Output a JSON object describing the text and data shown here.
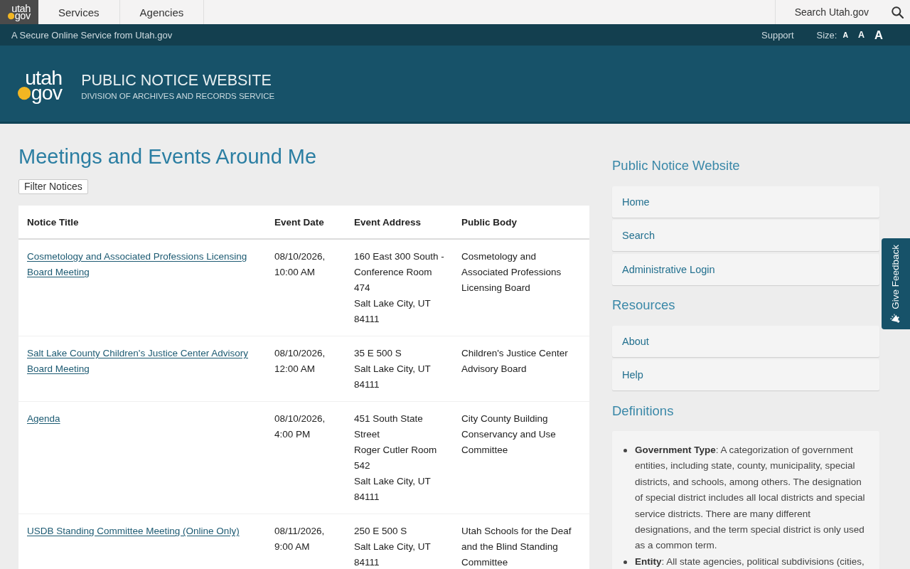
{
  "top_bar": {
    "logo": {
      "line_1": "utah",
      "line_2": "gov"
    },
    "nav_tabs": [
      {
        "label": "Services"
      },
      {
        "label": "Agencies"
      }
    ],
    "search_label": "Search Utah.gov"
  },
  "secure_bar": {
    "text": "A Secure Online Service from Utah.gov",
    "support_link": "Support",
    "size_label": "Size:",
    "size_options": [
      {
        "label": "A",
        "kind": "small"
      },
      {
        "label": "A",
        "kind": "medium"
      },
      {
        "label": "A",
        "kind": "large"
      }
    ]
  },
  "header": {
    "logo": {
      "line_1": "utah",
      "line_2": "gov"
    },
    "title": "PUBLIC NOTICE WEBSITE",
    "subtitle": "DIVISION OF ARCHIVES AND RECORDS SERVICE"
  },
  "main": {
    "heading": "Meetings and Events Around Me",
    "filter_button": "Filter Notices",
    "table": {
      "columns": [
        "Notice Title",
        "Event Date",
        "Event Address",
        "Public Body"
      ],
      "rows": [
        {
          "notice_title": "Cosmetology and Associated Professions Licensing Board Meeting",
          "event_date": "08/10/2026, 10:00 AM",
          "event_address": [
            "160 East 300 South - Conference Room 474",
            "Salt Lake City, UT 84111"
          ],
          "public_body": "Cosmetology and Associated Professions Licensing Board"
        },
        {
          "notice_title": "Salt Lake County Children's Justice Center Advisory Board Meeting",
          "event_date": "08/10/2026, 12:00 AM",
          "event_address": [
            "35 E 500 S",
            "Salt Lake City, UT 84111"
          ],
          "public_body": "Children's Justice Center Advisory Board"
        },
        {
          "notice_title": "Agenda",
          "event_date": "08/10/2026, 4:00 PM",
          "event_address": [
            "451 South State Street",
            "Roger Cutler Room 542",
            "Salt Lake City, UT 84111"
          ],
          "public_body": "City County Building Conservancy and Use Committee"
        },
        {
          "notice_title": "USDB Standing Committee Meeting (Online Only)",
          "event_date": "08/11/2026, 9:00 AM",
          "event_address": [
            "250 E 500 S",
            "Salt Lake City, UT 84111"
          ],
          "public_body": "Utah Schools for the Deaf and the Blind Standing Committee"
        }
      ]
    }
  },
  "sidebar": {
    "sections": [
      {
        "kind": "links",
        "heading": "Public Notice Website",
        "links": [
          "Home",
          "Search",
          "Administrative Login"
        ]
      },
      {
        "kind": "links",
        "heading": "Resources",
        "links": [
          "About",
          "Help"
        ]
      },
      {
        "kind": "definitions",
        "heading": "Definitions",
        "definitions": [
          "**Government Type**: A categorization of government entities, including state, county, municipality, special districts, and schools, among others. The designation of special district includes all local districts and special service districts. There are many different designations, and the term special district is only used as a common term.",
          "**Entity**: All state agencies, political subdivisions (cities,"
        ]
      }
    ]
  },
  "feedback_tab": {
    "label": "Give Feedback"
  }
}
